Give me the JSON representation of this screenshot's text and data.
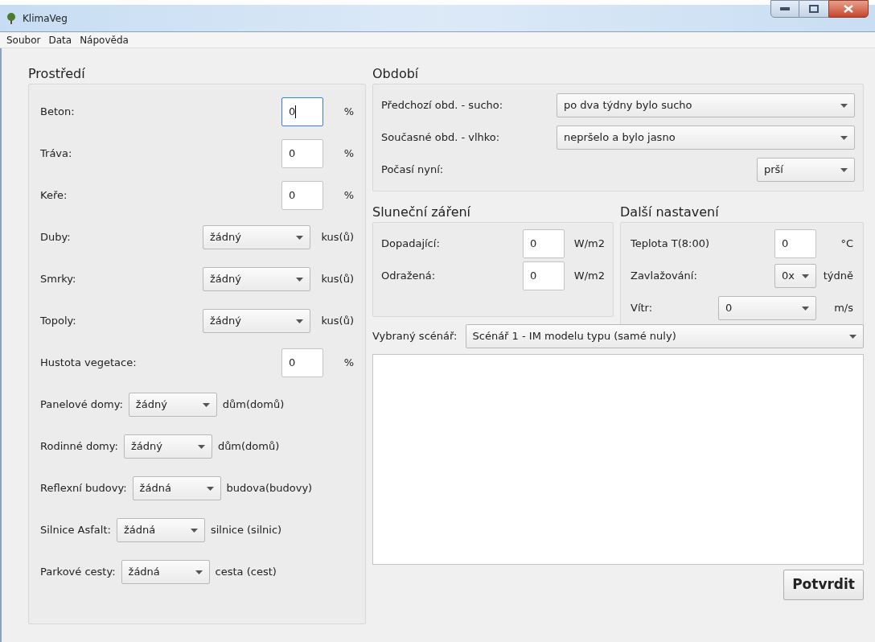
{
  "window": {
    "title": "KlimaVeg"
  },
  "menu": [
    "Soubor",
    "Data",
    "Nápověda"
  ],
  "environment": {
    "title": "Prostředí",
    "rows": [
      {
        "kind": "input",
        "label": "Beton:",
        "value": "0",
        "unit": "%",
        "focused": true
      },
      {
        "kind": "input",
        "label": "Tráva:",
        "value": "0",
        "unit": "%",
        "focused": false
      },
      {
        "kind": "input",
        "label": "Keře:",
        "value": "0",
        "unit": "%",
        "focused": false
      },
      {
        "kind": "select",
        "label": "Duby:",
        "value": "žádný",
        "unit": "kus(ů)"
      },
      {
        "kind": "select",
        "label": "Smrky:",
        "value": "žádný",
        "unit": "kus(ů)"
      },
      {
        "kind": "select",
        "label": "Topoly:",
        "value": "žádný",
        "unit": "kus(ů)"
      },
      {
        "kind": "input",
        "label": "Hustota vegetace:",
        "value": "0",
        "unit": "%",
        "focused": false
      },
      {
        "kind": "compact",
        "label": "Panelové domy:",
        "value": "žádný",
        "unit": "dům(domů)"
      },
      {
        "kind": "compact",
        "label": "Rodinné domy:",
        "value": "žádný",
        "unit": "dům(domů)"
      },
      {
        "kind": "compact",
        "label": "Reflexní budovy:",
        "value": "žádná",
        "unit": "budova(budovy)"
      },
      {
        "kind": "compact",
        "label": "Silnice Asfalt:",
        "value": "žádná",
        "unit": "silnice (silnic)"
      },
      {
        "kind": "compact",
        "label": "Parkové cesty:",
        "value": "žádná",
        "unit": "cesta (cest)"
      }
    ]
  },
  "period": {
    "title": "Období",
    "rows": [
      {
        "kind": "wide",
        "label": "Předchozí obd. - sucho:",
        "value": "po dva týdny bylo sucho"
      },
      {
        "kind": "wide",
        "label": "Současné obd. - vlhko:",
        "value": "nepršelo a bylo jasno"
      },
      {
        "kind": "narrow",
        "label": "Počasí nyní:",
        "value": "prší"
      }
    ]
  },
  "solar": {
    "title": "Sluneční záření",
    "rows": [
      {
        "label": "Dopadající:",
        "value": "0",
        "unit": "W/m2"
      },
      {
        "label": "Odražená:",
        "value": "0",
        "unit": "W/m2"
      }
    ]
  },
  "settings": {
    "title": "Další nastavení",
    "rows": [
      {
        "kind": "input",
        "label": "Teplota T(8:00)",
        "value": "0",
        "unit": "°C"
      },
      {
        "kind": "small-select",
        "label": "Zavlažování:",
        "value": "0x",
        "unit": "týdně"
      },
      {
        "kind": "select",
        "label": "Vítr:",
        "value": "0",
        "unit": "m/s"
      }
    ]
  },
  "scenario": {
    "label": "Vybraný scénář:",
    "value": "Scénář 1 - IM modelu typu (samé nuly)"
  },
  "confirm_button": "Potvrdit"
}
